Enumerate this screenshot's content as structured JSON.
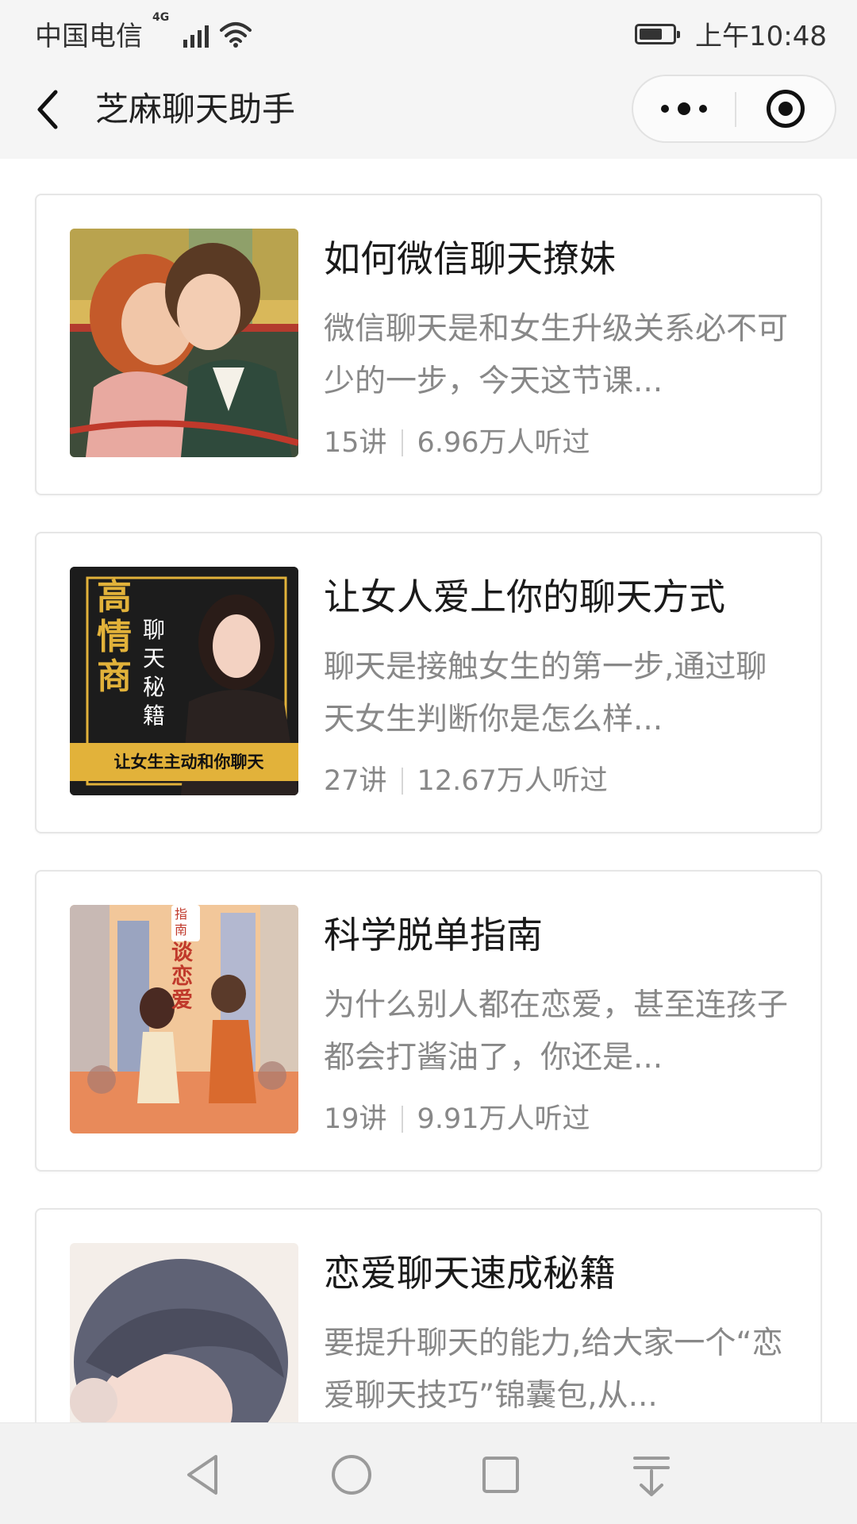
{
  "status_bar": {
    "carrier": "中国电信",
    "network": "4G",
    "time": "上午10:48",
    "battery_level": 0.7
  },
  "nav": {
    "title": "芝麻聊天助手"
  },
  "courses": [
    {
      "title": "如何微信聊天撩妹",
      "desc": "微信聊天是和女生升级关系必不可少的一步，今天这节课...",
      "lessons": "15讲",
      "listeners": "6.96万人听过",
      "cover": "couple-kissing-illustration"
    },
    {
      "title": "让女人爱上你的聊天方式",
      "desc": "聊天是接触女生的第一步,通过聊天女生判断你是怎么样...",
      "lessons": "27讲",
      "listeners": "12.67万人听过",
      "cover": "woman-portrait-poster",
      "cover_text": {
        "big": "高情商",
        "small": "聊天秘籍",
        "quote": "让女生主动和你聊天"
      }
    },
    {
      "title": "科学脱单指南",
      "desc": "为什么别人都在恋爱，甚至连孩子都会打酱油了，你还是...",
      "lessons": "19讲",
      "listeners": "9.91万人听过",
      "cover": "city-street-couple-illustration",
      "cover_text": {
        "tag": "指南",
        "vertical": "谈恋爱"
      }
    },
    {
      "title": "恋爱聊天速成秘籍",
      "desc": "要提升聊天的能力,给大家一个“恋爱聊天技巧”锦囊包,从...",
      "cover": "anime-boy-illustration"
    }
  ],
  "bottom_nav": {
    "icons": [
      "back-triangle-icon",
      "home-circle-icon",
      "recent-square-icon",
      "pull-down-icon"
    ]
  },
  "colors": {
    "status_bg": "#f5f5f5",
    "title_text": "#1a1a1a",
    "secondary_text": "#888888",
    "card_border": "#e6e6e6"
  }
}
